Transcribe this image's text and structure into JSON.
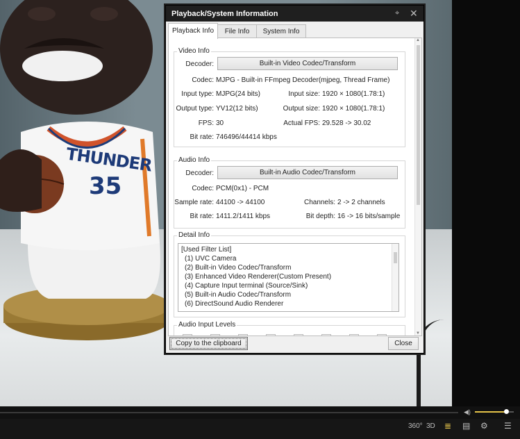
{
  "dialog": {
    "title": "Playback/System Information",
    "pin_icon": "pin-icon",
    "close_icon": "close-icon"
  },
  "tabs": [
    {
      "label": "Playback Info",
      "active": true
    },
    {
      "label": "File Info",
      "active": false
    },
    {
      "label": "System Info",
      "active": false
    }
  ],
  "video_info": {
    "group_label": "Video Info",
    "decoder_label": "Decoder:",
    "decoder_button": "Built-in Video Codec/Transform",
    "codec_label": "Codec:",
    "codec_value": "MJPG - Built-in FFmpeg Decoder(mjpeg, Thread Frame)",
    "input_type_label": "Input type:",
    "input_type_value": "MJPG(24 bits)",
    "input_size_label": "Input size:",
    "input_size_value": "1920 × 1080(1.78:1)",
    "output_type_label": "Output type:",
    "output_type_value": "YV12(12 bits)",
    "output_size_label": "Output size:",
    "output_size_value": "1920 × 1080(1.78:1)",
    "fps_label": "FPS:",
    "fps_value": "30",
    "actual_fps_label": "Actual FPS:",
    "actual_fps_value": "29.528 -> 30.02",
    "bitrate_label": "Bit rate:",
    "bitrate_value": "746496/44414 kbps"
  },
  "audio_info": {
    "group_label": "Audio Info",
    "decoder_label": "Decoder:",
    "decoder_button": "Built-in Audio Codec/Transform",
    "codec_label": "Codec:",
    "codec_value": "PCM(0x1) - PCM",
    "sample_rate_label": "Sample rate:",
    "sample_rate_value": "44100 -> 44100",
    "channels_label": "Channels:",
    "channels_value": "2 -> 2 channels",
    "bitrate_label": "Bit rate:",
    "bitrate_value": "1411.2/1411 kbps",
    "bit_depth_label": "Bit depth:",
    "bit_depth_value": "16 -> 16 bits/sample"
  },
  "detail_info": {
    "group_label": "Detail Info",
    "lines": [
      "[Used Filter List]",
      "(1) UVC Camera",
      "(2) Built-in Video Codec/Transform",
      "(3) Enhanced Video Renderer(Custom Present)",
      "(4) Capture Input terminal (Source/Sink)",
      "(5) Built-in Audio Codec/Transform",
      "(6) DirectSound Audio Renderer"
    ]
  },
  "audio_levels": {
    "group_label": "Audio Input Levels"
  },
  "footer": {
    "copy_button": "Copy to the clipboard",
    "close_button": "Close"
  },
  "player": {
    "video_text_line1": "THUNDER",
    "video_text_line2": "35",
    "volume_level": 0.8,
    "controls": [
      {
        "name": "360-button",
        "label": "360°"
      },
      {
        "name": "3d-button",
        "label": "3D"
      },
      {
        "name": "playlist-search-button",
        "label": "≣"
      },
      {
        "name": "subtitle-button",
        "label": "▤"
      },
      {
        "name": "settings-button",
        "label": "⚙"
      },
      {
        "name": "menu-button",
        "label": "☰"
      }
    ],
    "accent": "#e5c44a"
  }
}
